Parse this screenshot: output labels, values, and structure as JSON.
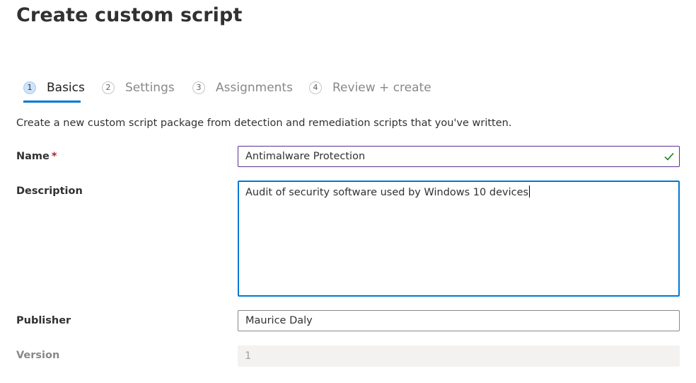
{
  "page": {
    "title": "Create custom script"
  },
  "wizard": {
    "steps": [
      {
        "number": "1",
        "label": "Basics",
        "active": true
      },
      {
        "number": "2",
        "label": "Settings",
        "active": false
      },
      {
        "number": "3",
        "label": "Assignments",
        "active": false
      },
      {
        "number": "4",
        "label": "Review + create",
        "active": false
      }
    ]
  },
  "form": {
    "intro": "Create a new custom script package from detection and remediation scripts that you've written.",
    "name": {
      "label": "Name",
      "required_mark": "*",
      "value": "Antimalware Protection",
      "status_icon": "check-icon"
    },
    "description": {
      "label": "Description",
      "value": "Audit of security software used by Windows 10 devices"
    },
    "publisher": {
      "label": "Publisher",
      "value": "Maurice Daly"
    },
    "version": {
      "label": "Version",
      "value": "1"
    }
  },
  "colors": {
    "accent": "#0078d4",
    "valid_check": "#107c10",
    "required": "#a4262c"
  }
}
